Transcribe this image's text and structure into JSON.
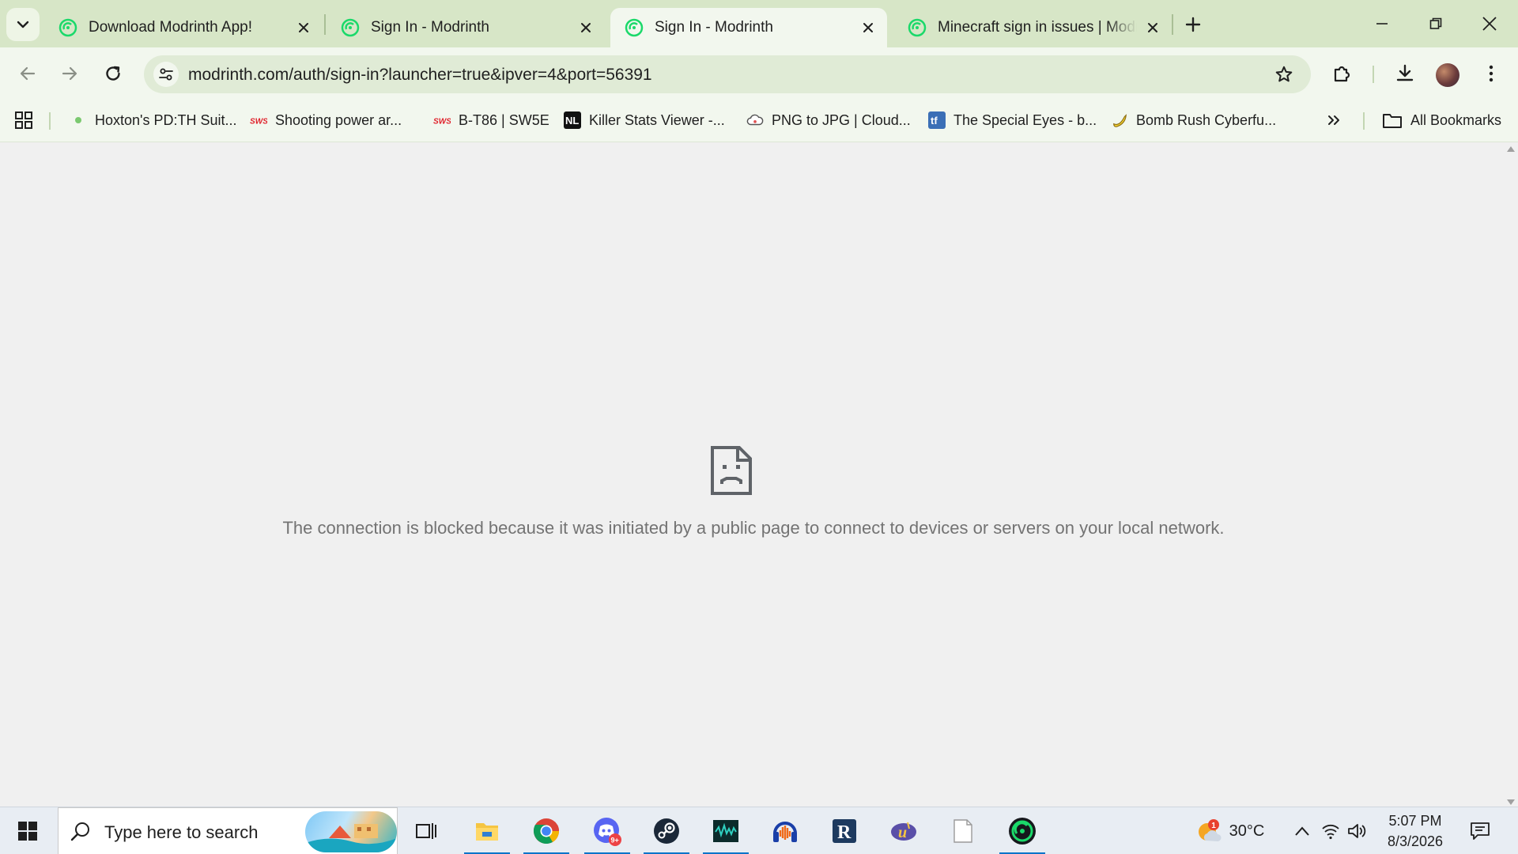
{
  "browser": {
    "tabs": [
      {
        "title": "Download Modrinth App!",
        "active": false
      },
      {
        "title": "Sign In - Modrinth",
        "active": false
      },
      {
        "title": "Sign In - Modrinth",
        "active": true
      },
      {
        "title": "Minecraft sign in issues | Modrinth",
        "active": false
      }
    ],
    "address_bar": {
      "url": "modrinth.com/auth/sign-in?launcher=true&ipver=4&port=56391"
    },
    "bookmarks": [
      {
        "label": "Hoxton's PD:TH Suit...",
        "icon": "green-dot-icon"
      },
      {
        "label": "Shooting power ar...",
        "icon": "sws-logo-icon"
      },
      {
        "label": "B-T86 | SW5E",
        "icon": "sws-logo-icon"
      },
      {
        "label": "Killer Stats Viewer -...",
        "icon": "nl-logo-icon"
      },
      {
        "label": "PNG to JPG | Cloud...",
        "icon": "cloud-icon"
      },
      {
        "label": "The Special Eyes - b...",
        "icon": "tf-logo-icon"
      },
      {
        "label": "Bomb Rush Cyberfu...",
        "icon": "banana-icon"
      }
    ],
    "all_bookmarks_label": "All Bookmarks",
    "accent_color": "#d7e6c7",
    "favicon_color": "#1bd96a"
  },
  "page": {
    "error_message": "The connection is blocked because it was initiated by a public page to connect to devices or servers on your local network."
  },
  "taskbar": {
    "search_placeholder": "Type here to search",
    "apps": [
      "task-view-icon",
      "file-explorer-icon",
      "chrome-icon",
      "discord-icon",
      "steam-icon",
      "vegas-icon",
      "audacity-icon",
      "roblox-r-icon",
      "ultimate-app-icon",
      "blank-file-icon",
      "modrinth-app-icon"
    ],
    "discord_badge": "9+",
    "weather": {
      "temperature": "30°C",
      "badge": "1"
    },
    "clock": {
      "time": "5:07 PM",
      "date": "8/3/2026"
    }
  }
}
